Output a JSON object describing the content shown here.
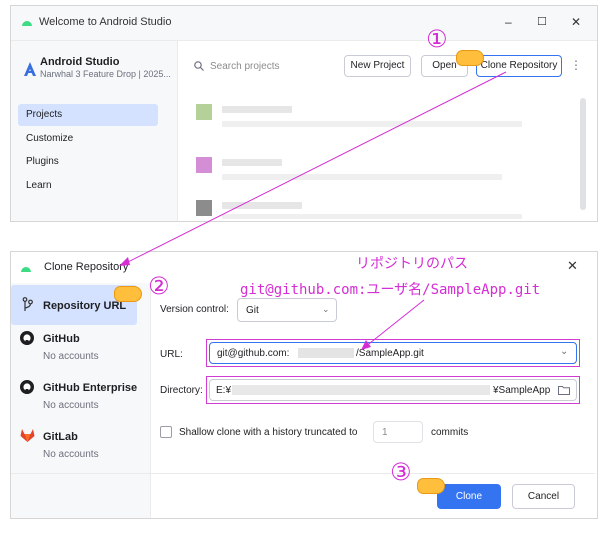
{
  "welcome_window": {
    "title": "Welcome to Android Studio",
    "app_name": "Android Studio",
    "app_version": "Narwhal 3 Feature Drop | 2025...",
    "sidebar": [
      "Projects",
      "Customize",
      "Plugins",
      "Learn"
    ],
    "search_placeholder": "Search projects",
    "buttons": {
      "new_project": "New Project",
      "open": "Open",
      "clone": "Clone Repository"
    },
    "more_glyph": "⋮",
    "window_controls": [
      "–",
      "☐",
      "✕"
    ]
  },
  "clone_dialog": {
    "title": "Clone Repository",
    "sources": [
      {
        "name": "Repository URL",
        "sub": "",
        "icon": "vcs-branch-icon"
      },
      {
        "name": "GitHub",
        "sub": "No accounts",
        "icon": "github-icon"
      },
      {
        "name": "GitHub Enterprise",
        "sub": "No accounts",
        "icon": "github-icon"
      },
      {
        "name": "GitLab",
        "sub": "No accounts",
        "icon": "gitlab-icon"
      }
    ],
    "version_control_label": "Version control:",
    "version_control_value": "Git",
    "url_label": "URL:",
    "url_prefix": "git@github.com:",
    "url_suffix": "/SampleApp.git",
    "directory_label": "Directory:",
    "directory_prefix": "E:¥",
    "directory_suffix": "¥SampleApp",
    "shallow_label": "Shallow clone with a history truncated to",
    "shallow_value": "1",
    "shallow_unit": "commits",
    "clone_button": "Clone",
    "cancel_button": "Cancel"
  },
  "annotations": {
    "step1": "①",
    "step2": "②",
    "step3": "③",
    "path_label": "リポジトリのパス",
    "path_example": "git@github.com:ユーザ名/SampleApp.git",
    "accent_color": "#d42dd4"
  }
}
